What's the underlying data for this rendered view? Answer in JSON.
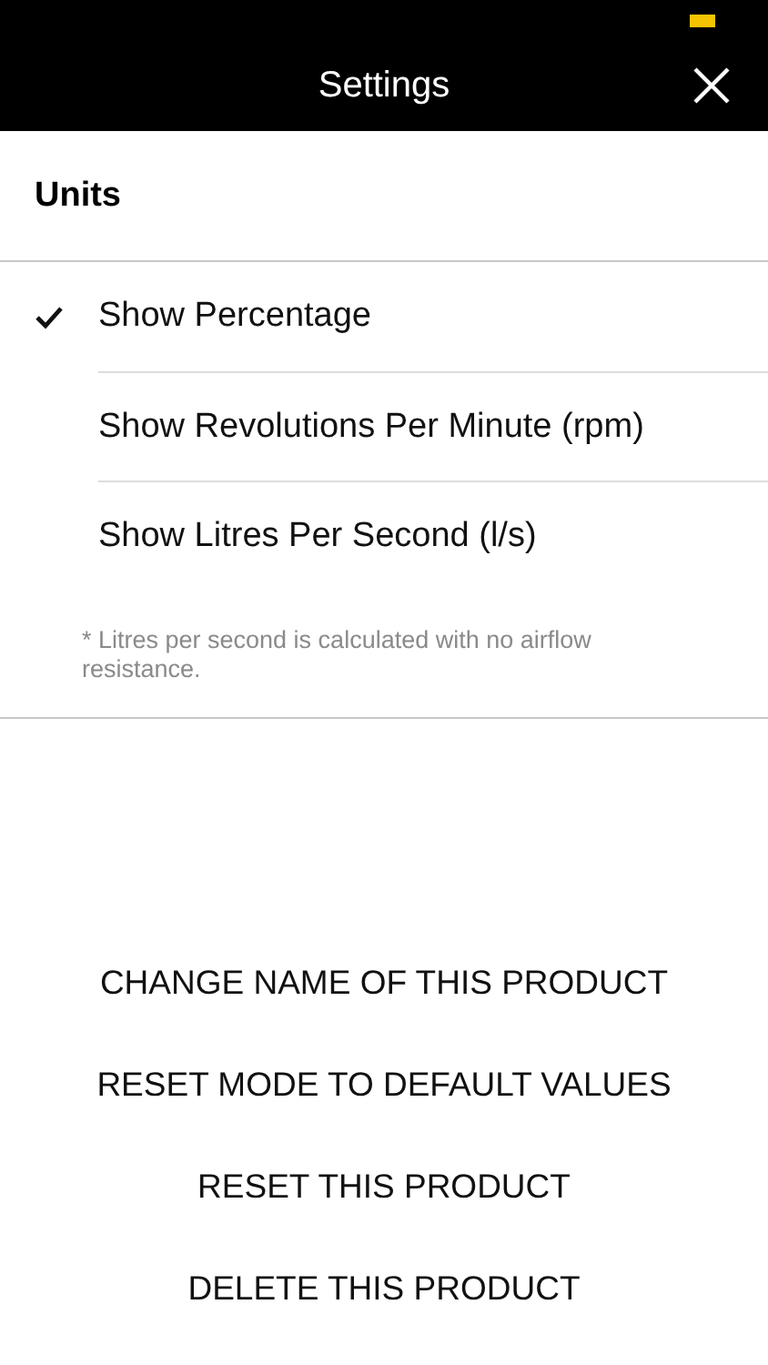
{
  "header": {
    "title": "Settings"
  },
  "section": {
    "title": "Units"
  },
  "options": [
    {
      "label": "Show Percentage",
      "selected": true
    },
    {
      "label": "Show Revolutions Per Minute (rpm)",
      "selected": false
    },
    {
      "label": "Show Litres Per Second (l/s)",
      "selected": false
    }
  ],
  "note": "* Litres per second is calculated with no airflow resistance.",
  "actions": [
    "CHANGE NAME OF THIS PRODUCT",
    "RESET MODE TO DEFAULT VALUES",
    "RESET THIS PRODUCT",
    "DELETE THIS PRODUCT"
  ]
}
